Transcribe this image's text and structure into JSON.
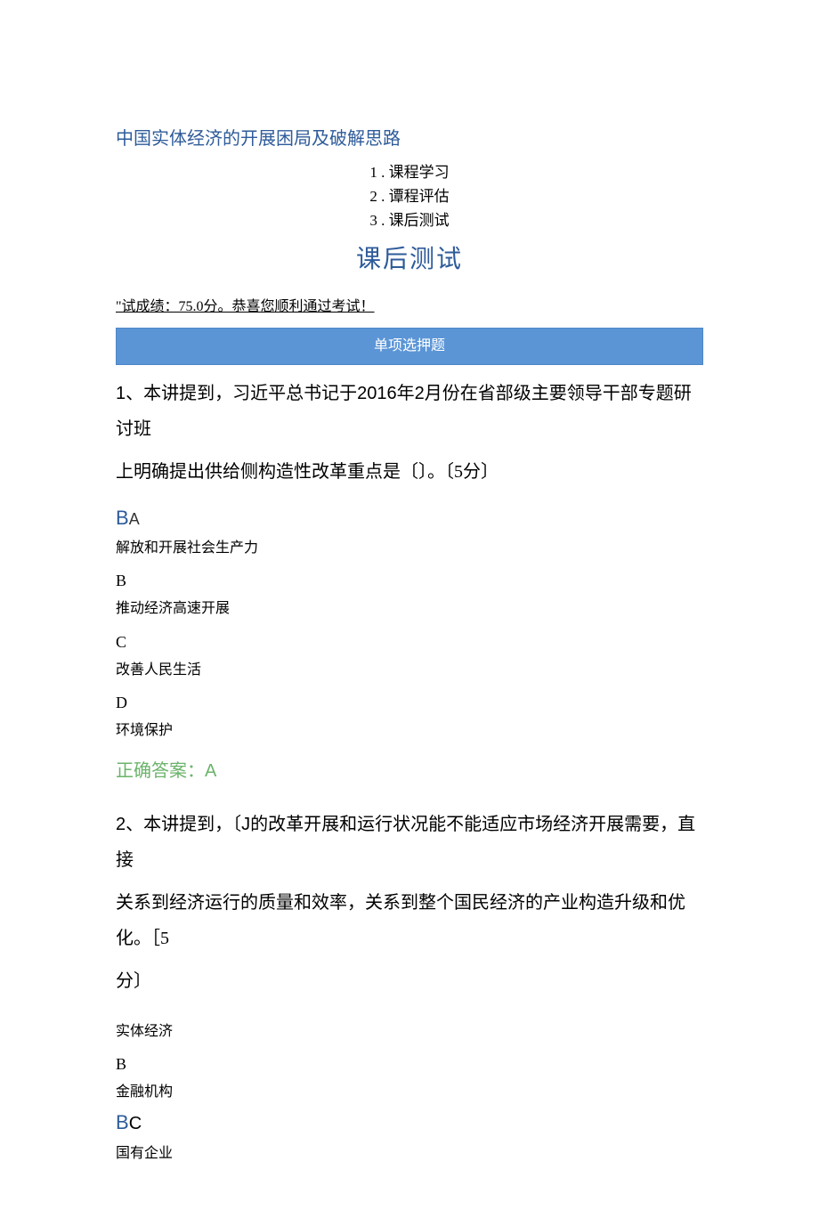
{
  "page_title": "中国实体经济的开展困局及破解思路",
  "tabs": {
    "t1": "1 . 课程学习",
    "t2": "2 . 谭程评估",
    "t3": "3 . 课后测试"
  },
  "heading": "课后测试",
  "score_line": "\"试成绩：75.0分。恭喜您顺利通过考试！",
  "section_bar": "单项选押题",
  "q1": {
    "stem_l1_a": "1",
    "stem_l1_b": "、本讲提到，习近平总书记于",
    "stem_l1_c": "2016",
    "stem_l1_d": "年",
    "stem_l1_e": "2",
    "stem_l1_f": "月份在省部级主要领导干部专题研讨班",
    "stem_l2": "上明确提出供给侧构造性改革重点是〔〕。〔5分〕",
    "selected_prefix": "B",
    "selected_letter": "A",
    "optA_text": "解放和开展社会生产力",
    "optB_key": "B",
    "optB_text": "推动经济高速开展",
    "optC_key": "C",
    "optC_text": "改善人民生活",
    "optD_key": "D",
    "optD_text": "环境保护",
    "correct_label": "正确答案：",
    "correct_value": "A"
  },
  "q2": {
    "stem_l1_a": "2",
    "stem_l1_b": "、本讲提到，〔",
    "stem_l1_c": "J",
    "stem_l1_d": "的改革开展和运行状况能不能适应市场经济开展需要，直接",
    "stem_l2": "关系到经济运行的质量和效率，关系到整个国民经济的产业构造升级和优化。［5",
    "stem_l3": "分〕",
    "optA_text": "实体经济",
    "optB_key": "B",
    "optB_text": "金融机构",
    "optC_prefix": "B",
    "optC_letter": "C",
    "optC_text": "国有企业"
  }
}
